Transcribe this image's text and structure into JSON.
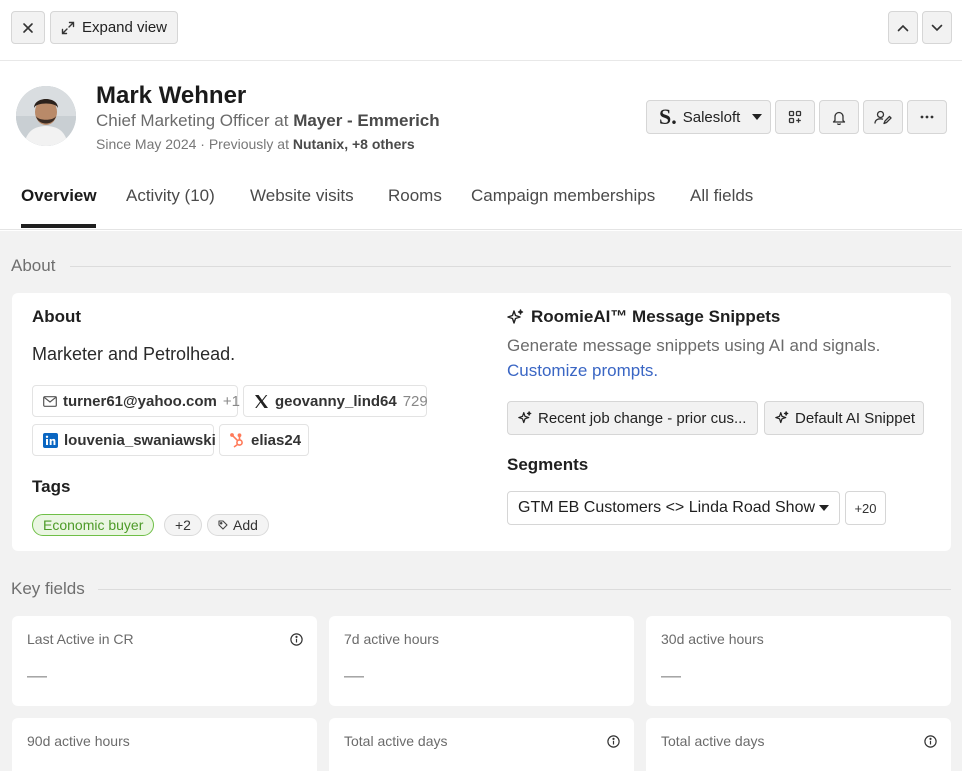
{
  "toolbar": {
    "expand_label": "Expand view"
  },
  "profile": {
    "name": "Mark Wehner",
    "role_title": "Chief Marketing Officer",
    "role_at": "at",
    "company": "Mayer - Emmerich",
    "since": "Since May 2024 · Previously at",
    "previous_company": "Nutanix, +8 others"
  },
  "actions": {
    "salesloft_logo": "S.",
    "salesloft_label": "Salesloft"
  },
  "tabs": [
    {
      "label": "Overview",
      "active": true
    },
    {
      "label": "Activity (10)",
      "active": false
    },
    {
      "label": "Website visits",
      "active": false
    },
    {
      "label": "Rooms",
      "active": false
    },
    {
      "label": "Campaign memberships",
      "active": false
    },
    {
      "label": "All fields",
      "active": false
    }
  ],
  "about_section": {
    "title": "About",
    "card_title": "About",
    "bio": "Marketer and Petrolhead.",
    "contacts": {
      "email": "turner61@yahoo.com",
      "email_more": "+1",
      "x_handle": "geovanny_lind64",
      "x_count": "729",
      "linkedin": "louvenia_swaniawski",
      "hubspot": "elias24"
    },
    "tags_title": "Tags",
    "tags": {
      "primary": "Economic buyer",
      "more": "+2",
      "add": "Add"
    }
  },
  "ai": {
    "title": "RoomieAI™ Message Snippets",
    "description": "Generate message snippets using AI and signals.",
    "link": "Customize prompts.",
    "snippet_1": "Recent job change - prior cus...",
    "snippet_2": "Default AI Snippet"
  },
  "segments": {
    "title": "Segments",
    "selected": "GTM EB Customers <> Linda Road Show",
    "more": "+20"
  },
  "key_fields": {
    "title": "Key fields",
    "items": [
      {
        "label": "Last Active in CR",
        "value": "—"
      },
      {
        "label": "7d active hours",
        "value": "—"
      },
      {
        "label": "30d active hours",
        "value": "—"
      },
      {
        "label": "90d active hours",
        "value": ""
      },
      {
        "label": "Total active days",
        "value": ""
      },
      {
        "label": "Total active days",
        "value": ""
      }
    ]
  },
  "colors": {
    "accent_link": "#3a66c4",
    "tag_green": "#4d9b28",
    "hubspot_orange": "#ff7a59",
    "linkedin_blue": "#0a66c2"
  }
}
